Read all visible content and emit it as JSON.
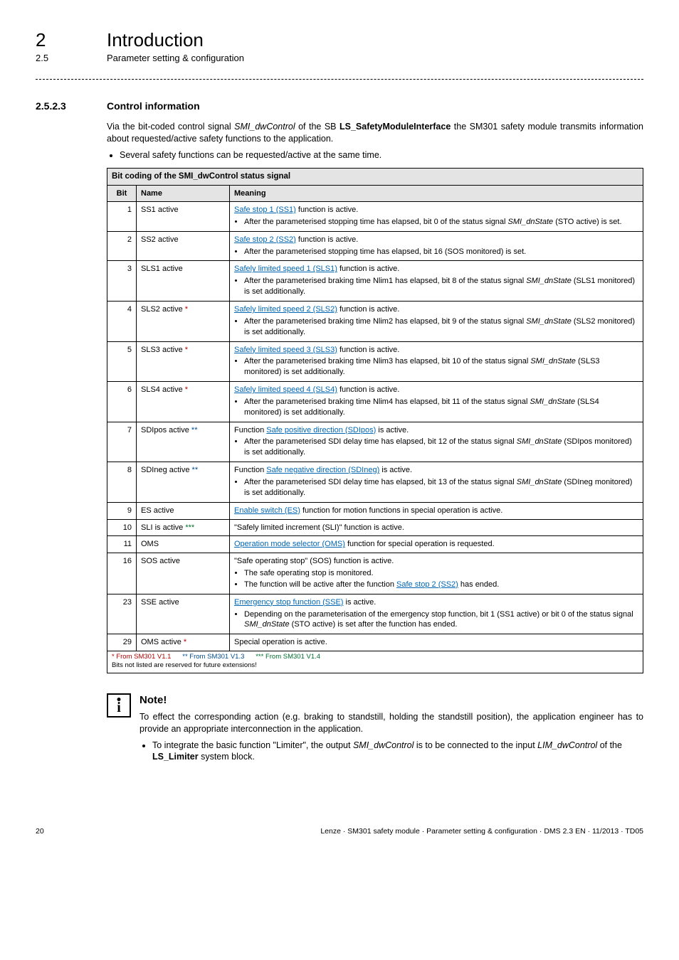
{
  "header": {
    "chapter_num": "2",
    "chapter_title": "Introduction",
    "section_num": "2.5",
    "section_title": "Parameter setting & configuration"
  },
  "subsection": {
    "num": "2.5.2.3",
    "title": "Control information"
  },
  "intro": {
    "p1_a": "Via the bit-coded control signal ",
    "p1_sig": "SMI_dwControl",
    "p1_b": " of the SB ",
    "p1_sb": "LS_SafetyModuleInterface",
    "p1_c": " the SM301 safety module transmits information about requested/active safety functions to the application.",
    "bullet1": "Several safety functions can be requested/active at the same time."
  },
  "table": {
    "caption": "Bit coding of the SMI_dwControl status signal",
    "headers": {
      "bit": "Bit",
      "name": "Name",
      "meaning": "Meaning"
    },
    "rows": [
      {
        "bit": "1",
        "name": "SS1 active",
        "link": "Safe stop 1 (SS1)",
        "after_link": " function is active.",
        "bullets": [
          {
            "pre": "After the parameterised stopping time has elapsed, bit 0 of the status signal ",
            "em": "SMI_dnState",
            "post": " (STO active) is set."
          }
        ]
      },
      {
        "bit": "2",
        "name": "SS2 active",
        "link": "Safe stop 2 (SS2)",
        "after_link": " function is active.",
        "bullets": [
          {
            "pre": "After the parameterised stopping time has elapsed, bit 16 (SOS monitored) is set.",
            "em": "",
            "post": ""
          }
        ]
      },
      {
        "bit": "3",
        "name": "SLS1 active",
        "link": "Safely limited speed 1 (SLS1)",
        "after_link": " function is active.",
        "bullets": [
          {
            "pre": "After the parameterised braking time Nlim1 has elapsed, bit 8 of the status signal ",
            "em": "SMI_dnState",
            "post": " (SLS1 monitored) is set additionally."
          }
        ]
      },
      {
        "bit": "4",
        "name": "SLS2 active ",
        "name_star": "*",
        "link": "Safely limited speed 2 (SLS2)",
        "after_link": " function is active.",
        "bullets": [
          {
            "pre": "After the parameterised braking time Nlim2 has elapsed, bit 9 of the status signal ",
            "em": "SMI_dnState",
            "post": " (SLS2 monitored) is set additionally."
          }
        ]
      },
      {
        "bit": "5",
        "name": "SLS3 active ",
        "name_star": "*",
        "link": "Safely limited speed 3 (SLS3)",
        "after_link": " function is active.",
        "bullets": [
          {
            "pre": "After the parameterised braking time Nlim3 has elapsed, bit 10 of the status signal ",
            "em": "SMI_dnState",
            "post": " (SLS3 monitored) is set additionally."
          }
        ]
      },
      {
        "bit": "6",
        "name": "SLS4 active ",
        "name_star": "*",
        "link": "Safely limited speed 4 (SLS4)",
        "after_link": " function is active.",
        "bullets": [
          {
            "pre": "After the parameterised braking time Nlim4 has elapsed, bit 11 of the status signal ",
            "em": "SMI_dnState",
            "post": " (SLS4 monitored) is set additionally."
          }
        ]
      },
      {
        "bit": "7",
        "name": "SDIpos active ",
        "name_star": "**",
        "pre_text": "Function ",
        "link": "Safe positive direction (SDIpos)",
        "after_link": " is active.",
        "bullets": [
          {
            "pre": "After the parameterised SDI delay time has elapsed, bit 12 of the status signal ",
            "em": "SMI_dnState",
            "post": " (SDIpos monitored) is set additionally."
          }
        ]
      },
      {
        "bit": "8",
        "name": "SDIneg active ",
        "name_star": "**",
        "pre_text": "Function ",
        "link": "Safe negative direction (SDIneg)",
        "after_link": " is active.",
        "bullets": [
          {
            "pre": "After the parameterised SDI delay time has elapsed, bit 13 of the status signal ",
            "em": "SMI_dnState",
            "post": " (SDIneg monitored) is set additionally."
          }
        ]
      },
      {
        "bit": "9",
        "name": "ES active",
        "link": "Enable switch (ES)",
        "after_link": " function for motion functions in special operation is active."
      },
      {
        "bit": "10",
        "name": "SLI is active ",
        "name_star": "***",
        "plain": "\"Safely limited increment (SLI)\" function is active."
      },
      {
        "bit": "11",
        "name": "OMS",
        "link": "Operation mode selector (OMS)",
        "after_link": " function for special operation is requested."
      },
      {
        "bit": "16",
        "name": "SOS active",
        "plain": "\"Safe operating stop\" (SOS) function is active.",
        "bullets_plain": [
          "The safe operating stop is monitored."
        ],
        "bullets_link": [
          {
            "pre": "The function will be active after the function ",
            "link": "Safe stop 2 (SS2)",
            "post": " has ended."
          }
        ]
      },
      {
        "bit": "23",
        "name": "SSE active",
        "link": "Emergency stop function (SSE)",
        "after_link": " is active.",
        "bullets": [
          {
            "pre": "Depending on the parameterisation of the emergency stop function, bit 1 (SS1 active) or bit 0 of the status signal ",
            "em": "SMI_dnState",
            "post": " (STO active) is set after the function has ended."
          }
        ]
      },
      {
        "bit": "29",
        "name": "OMS active ",
        "name_star": "*",
        "plain": "Special operation is active."
      }
    ],
    "footnotes": {
      "f1": "* From SM301 V1.1",
      "f2": "** From SM301 V1.3",
      "f3": "*** From SM301 V1.4",
      "reserved": "Bits not listed are reserved for future extensions!"
    }
  },
  "note": {
    "title": "Note!",
    "p1": "To effect the corresponding action (e.g. braking to standstill, holding the standstill position), the application engineer has to provide an appropriate interconnection in the application.",
    "b1_a": "To integrate the basic function \"Limiter\", the output ",
    "b1_em1": "SMI_dwControl",
    "b1_b": " is to be connected to the input ",
    "b1_em2": "LIM_dwControl",
    "b1_c": " of the ",
    "b1_strong": "LS_Limiter",
    "b1_d": " system block."
  },
  "footer": {
    "page": "20",
    "text": "Lenze · SM301 safety module · Parameter setting & configuration · DMS 2.3 EN · 11/2013 · TD05"
  }
}
